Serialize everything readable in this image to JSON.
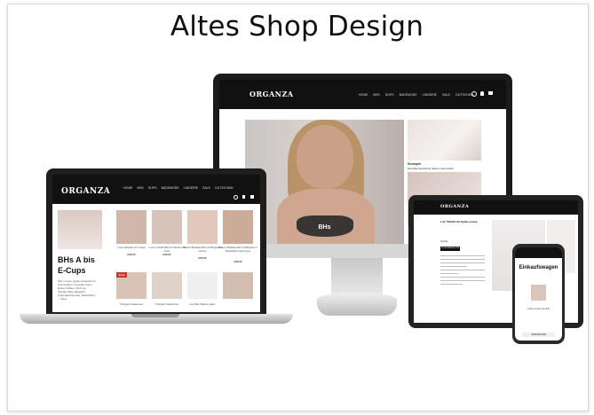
{
  "title": "Altes Shop Design",
  "brand": "ORGANZA",
  "brand_sub": "lingerie",
  "nav": [
    "HOME",
    "BHS",
    "SLIPS",
    "BADEMODE",
    "LINGERIE",
    "SALE",
    "GUTSCHEIN"
  ],
  "monitor": {
    "hero_label": "BHs",
    "side_label": "Strümpfe",
    "side_text": "Sexuelle herrlichste Seide unterstreicht"
  },
  "laptop": {
    "heading_line1": "BHs A bis",
    "heading_line2": "E-Cups",
    "intro": "Wer in einer großen Auswahl an Cup Größen, ob große Fourz, kleine Größen, Push up, Schalen BHs. Elegante Unterwäschemode. Softschalen ... Neue",
    "products": [
      {
        "name": "Luxe schwarz A-F Cups",
        "price": "€36,95"
      },
      {
        "name": "Luxe 4 Stück BH mit Spitzen-S einer",
        "price": "€36,95"
      },
      {
        "name": "Balcon Bralette BH mit Bügeln in Creme",
        "price": "€36,95"
      },
      {
        "name": "Balcon Bralette BH mit Bügeln in Rosé/light suchs ana",
        "price": "€36,95"
      },
      {
        "name": "Tüll ganz bedenzen",
        "price": ""
      },
      {
        "name": "Tüll ganz bedenzen",
        "price": ""
      },
      {
        "name": "Cup BH Ohanon ganz",
        "price": ""
      }
    ],
    "sale_badge": "SALE"
  },
  "tablet": {
    "product_title": "Lux Tüll-BH mit Spitze creme",
    "button": "IN DEN WARENKORB",
    "label": "Größe"
  },
  "phone": {
    "title": "Einkaufswagen",
    "note": "Gratis Versand ab 80€",
    "button": "WARENKORB"
  }
}
